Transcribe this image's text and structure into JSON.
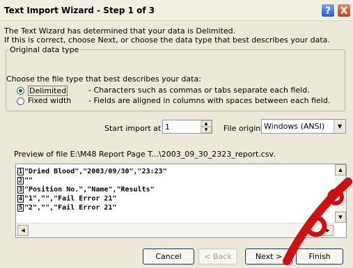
{
  "window": {
    "title": "Text Import Wizard - Step 1 of 3",
    "help_label": "?",
    "close_label": "X"
  },
  "intro": {
    "line1": "The Text Wizard has determined that your data is Delimited.",
    "line2": "If this is correct, choose Next, or choose the data type that best describes your data."
  },
  "original_data_type": {
    "legend": "Original data type",
    "prompt": "Choose the file type that best describes your data:",
    "options": [
      {
        "label": "Delimited",
        "description": "- Characters such as commas or tabs separate each field.",
        "selected": true
      },
      {
        "label": "Fixed width",
        "description": "- Fields are aligned in columns with spaces between each field.",
        "selected": false
      }
    ]
  },
  "start_import": {
    "label": "Start import at row:",
    "value": "1"
  },
  "file_origin": {
    "label": "File origin:",
    "value": "Windows (ANSI)"
  },
  "preview": {
    "label": "Preview of file E:\\M48 Report Page T...\\2003_09_30_2323_report.csv.",
    "lines": [
      {
        "num": "1",
        "text": "\"Dried Blood\",\"2003/09/30\",\"23:23\""
      },
      {
        "num": "2",
        "text": "\"\""
      },
      {
        "num": "3",
        "text": "\"Position No.\",\"Name\",\"Results\""
      },
      {
        "num": "4",
        "text": "\"1\",\"\",\"Fail  Error 21\""
      },
      {
        "num": "5",
        "text": "\"2\",\"\",\"Fail  Error 21\""
      }
    ]
  },
  "buttons": {
    "cancel": "Cancel",
    "back": "< Back",
    "next": "Next >",
    "finish": "Finish"
  },
  "colors": {
    "dialog_bg": "#ece9d8",
    "watermark": "#d01010"
  }
}
